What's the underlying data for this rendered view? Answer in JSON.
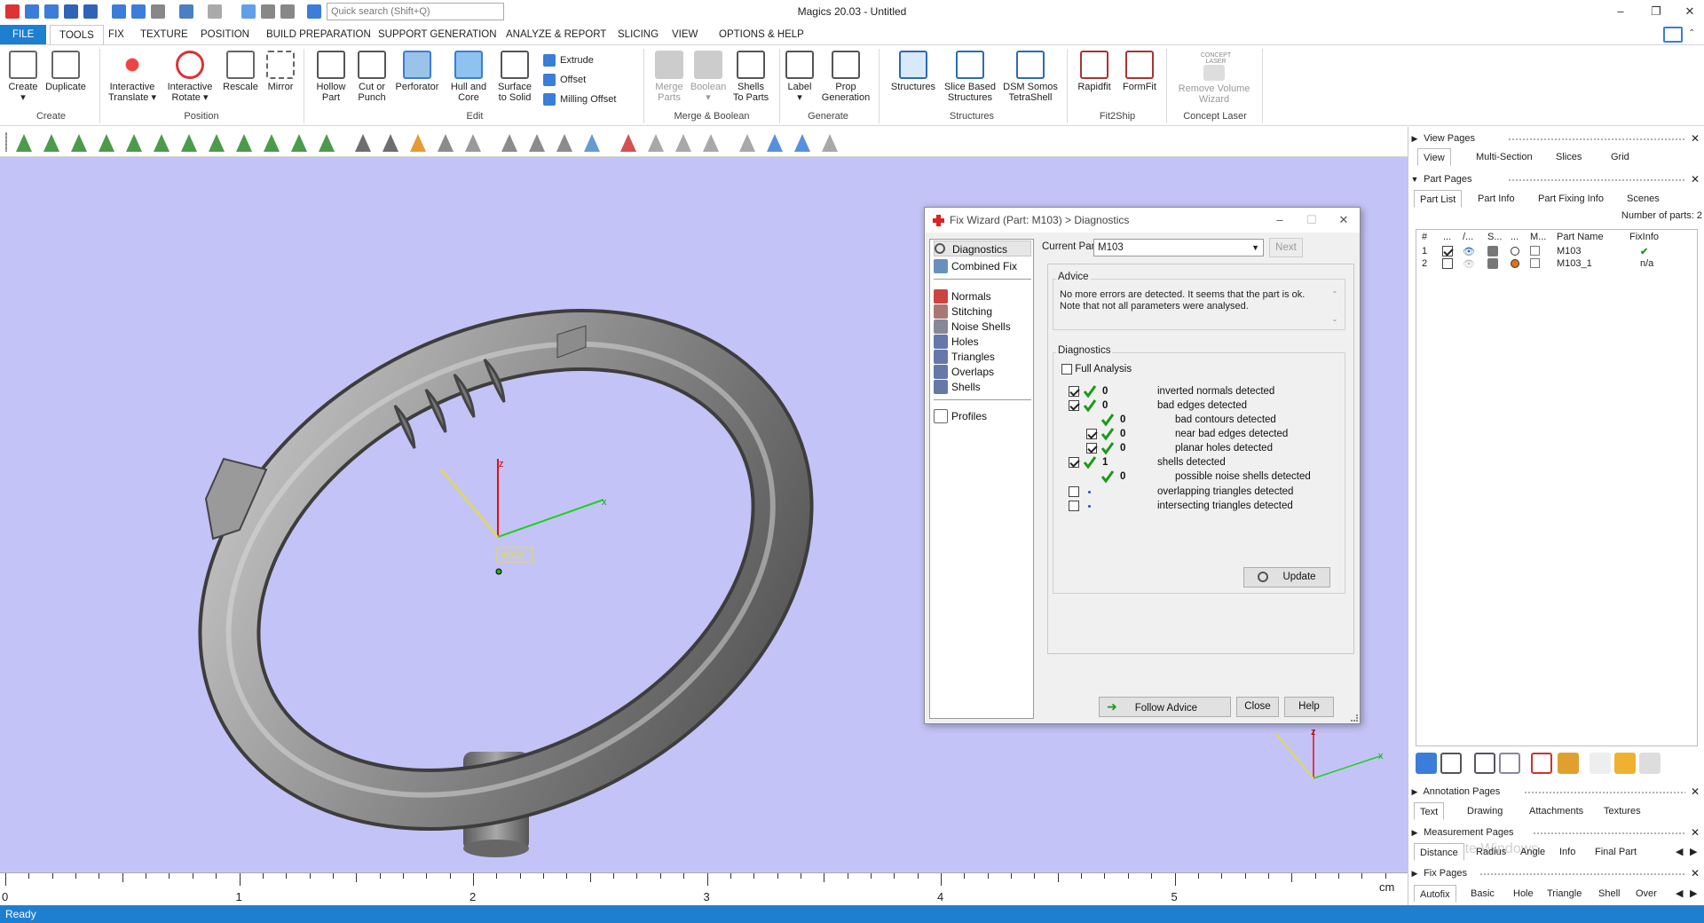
{
  "app": {
    "title": "Magics 20.03 - Untitled",
    "search_placeholder": "Quick search (Shift+Q)",
    "status": "Ready"
  },
  "menu": [
    "FILE",
    "TOOLS",
    "FIX",
    "TEXTURE",
    "POSITION",
    "BUILD PREPARATION",
    "SUPPORT GENERATION",
    "ANALYZE & REPORT",
    "SLICING",
    "VIEW",
    "OPTIONS & HELP"
  ],
  "ribbon": {
    "create": {
      "create": "Create",
      "duplicate": "Duplicate",
      "group": "Create"
    },
    "position": {
      "interactive_translate": "Interactive Translate",
      "interactive_rotate": "Interactive Rotate",
      "rescale": "Rescale",
      "mirror": "Mirror",
      "group": "Position"
    },
    "edit": {
      "hollow": "Hollow Part",
      "cut": "Cut or Punch",
      "perforator": "Perforator",
      "hull": "Hull and Core",
      "surface": "Surface to Solid",
      "extrude": "Extrude",
      "offset": "Offset",
      "milling": "Milling Offset",
      "group": "Edit"
    },
    "merge": {
      "merge": "Merge Parts",
      "boolean": "Boolean",
      "shells": "Shells To Parts",
      "group": "Merge & Boolean"
    },
    "generate": {
      "label": "Label",
      "prop": "Prop Generation",
      "group": "Generate"
    },
    "structures": {
      "structures": "Structures",
      "slice": "Slice Based Structures",
      "dsm": "DSM Somos TetraShell",
      "group": "Structures"
    },
    "fit2ship": {
      "rapidfit": "Rapidfit",
      "formfit": "FormFit",
      "group": "Fit2Ship"
    },
    "concept": {
      "remove": "Remove Volume Wizard",
      "logo": "CONCEPT LASER",
      "group": "Concept Laser"
    }
  },
  "viewport": {
    "wcs": "WCS",
    "axis_x": "x",
    "axis_z": "z",
    "ruler_labels": [
      "0",
      "1",
      "2",
      "3",
      "4",
      "5"
    ],
    "ruler_unit": "cm"
  },
  "dialog": {
    "title": "Fix Wizard (Part: M103) > Diagnostics",
    "nav": [
      "Diagnostics",
      "Combined Fix",
      "Normals",
      "Stitching",
      "Noise Shells",
      "Holes",
      "Triangles",
      "Overlaps",
      "Shells",
      "Profiles"
    ],
    "current_part_label": "Current Part:",
    "current_part": "M103",
    "next": "Next",
    "advice_title": "Advice",
    "advice_text": "No more errors are detected. It seems that the part is ok. Note that not all parameters were analysed.",
    "diagnostics_title": "Diagnostics",
    "full_analysis": "Full Analysis",
    "rows": [
      {
        "count": "0",
        "label": "inverted normals detected"
      },
      {
        "count": "0",
        "label": "bad edges detected"
      },
      {
        "count": "0",
        "label": "bad contours detected"
      },
      {
        "count": "0",
        "label": "near bad edges detected"
      },
      {
        "count": "0",
        "label": "planar holes detected"
      },
      {
        "count": "1",
        "label": "shells detected"
      },
      {
        "count": "0",
        "label": "possible noise shells detected"
      },
      {
        "count": "",
        "label": "overlapping triangles detected"
      },
      {
        "count": "",
        "label": "intersecting triangles detected"
      }
    ],
    "update": "Update",
    "follow_advice": "Follow Advice",
    "close": "Close",
    "help": "Help"
  },
  "panel": {
    "view_pages": "View Pages",
    "view_tabs": [
      "View",
      "Multi-Section",
      "Slices",
      "Grid"
    ],
    "part_pages": "Part Pages",
    "part_tabs": [
      "Part List",
      "Part Info",
      "Part Fixing Info",
      "Scenes"
    ],
    "num_parts": "Number of parts: 2",
    "columns": [
      "#",
      "...",
      "/...",
      "S...",
      "...",
      "M...",
      "Part Name",
      "FixInfo"
    ],
    "parts": [
      {
        "num": "1",
        "name": "M103",
        "fix": "✔"
      },
      {
        "num": "2",
        "name": "M103_1",
        "fix": "n/a"
      }
    ],
    "annotation_pages": "Annotation Pages",
    "annotation_tabs": [
      "Text",
      "Drawing",
      "Attachments",
      "Textures"
    ],
    "measurement_pages": "Measurement Pages",
    "measurement_tabs": [
      "Distance",
      "Radius",
      "Angle",
      "Info",
      "Final Part"
    ],
    "watermark": "Activate Windows",
    "fix_pages": "Fix Pages",
    "fix_tabs": [
      "Autofix",
      "Basic",
      "Hole",
      "Triangle",
      "Shell",
      "Over"
    ]
  },
  "colors": {
    "accent": "#1e7fd1",
    "viewport": "#c4c3f7",
    "check": "#1a9a1a"
  }
}
